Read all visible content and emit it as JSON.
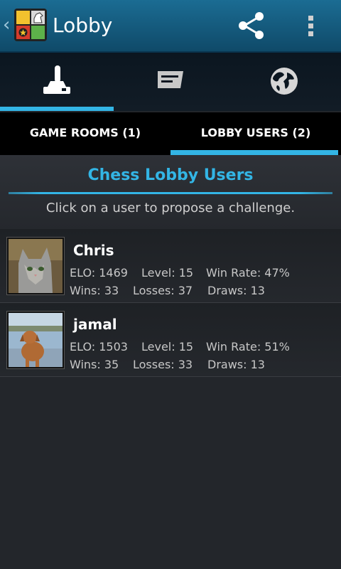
{
  "actionbar": {
    "title": "Lobby",
    "back": "‹"
  },
  "text_tabs": [
    {
      "label": "GAME ROOMS (1)",
      "selected": false
    },
    {
      "label": "LOBBY USERS (2)",
      "selected": true
    }
  ],
  "section": {
    "title": "Chess Lobby Users",
    "hint": "Click on a user to propose a challenge."
  },
  "users": [
    {
      "name": "Chris",
      "elo": "ELO: 1469",
      "level": "Level: 15",
      "win_rate": "Win Rate: 47%",
      "wins": "Wins: 33",
      "losses": "Losses: 37",
      "draws": "Draws: 13"
    },
    {
      "name": "jamal",
      "elo": "ELO: 1503",
      "level": "Level: 15",
      "win_rate": "Win Rate: 51%",
      "wins": "Wins: 35",
      "losses": "Losses: 33",
      "draws": "Draws: 13"
    }
  ],
  "colors": {
    "accent": "#33b5e5",
    "actionbar": "#16628a",
    "background": "#23262b"
  },
  "icons": [
    "back-chevron-icon",
    "app-logo-icon",
    "share-icon",
    "overflow-menu-icon",
    "joystick-icon",
    "chat-icon",
    "globe-icon"
  ]
}
